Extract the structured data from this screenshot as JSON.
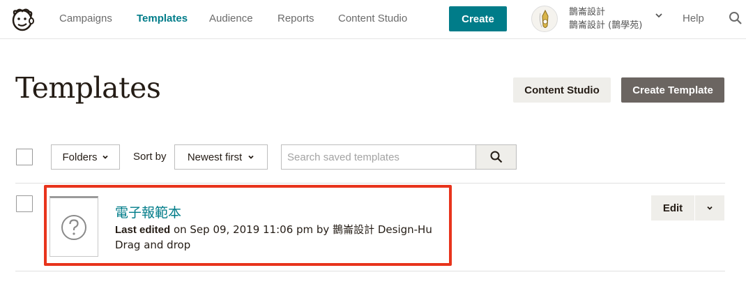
{
  "nav": {
    "links": [
      "Campaigns",
      "Templates",
      "Audience",
      "Reports",
      "Content Studio"
    ],
    "create_label": "Create",
    "account_line1": "鵲崙設計",
    "account_line2": "鵲崙設計 (鵲學苑)",
    "help_label": "Help"
  },
  "header": {
    "title": "Templates",
    "content_studio_label": "Content Studio",
    "create_template_label": "Create Template"
  },
  "toolbar": {
    "folders_label": "Folders",
    "sort_by_label": "Sort by",
    "sort_value": "Newest first",
    "search_placeholder": "Search saved templates"
  },
  "templates": [
    {
      "name": "電子報範本",
      "last_edited_label": "Last edited",
      "last_edited_text": " on Sep 09, 2019 11:06 pm by 鵲崙設計 Design-Hu",
      "type": "Drag and drop",
      "edit_label": "Edit"
    }
  ],
  "colors": {
    "accent": "#007c89",
    "highlight": "#e8341c",
    "dark_button": "#6b6561",
    "light_button": "#efeeea"
  }
}
